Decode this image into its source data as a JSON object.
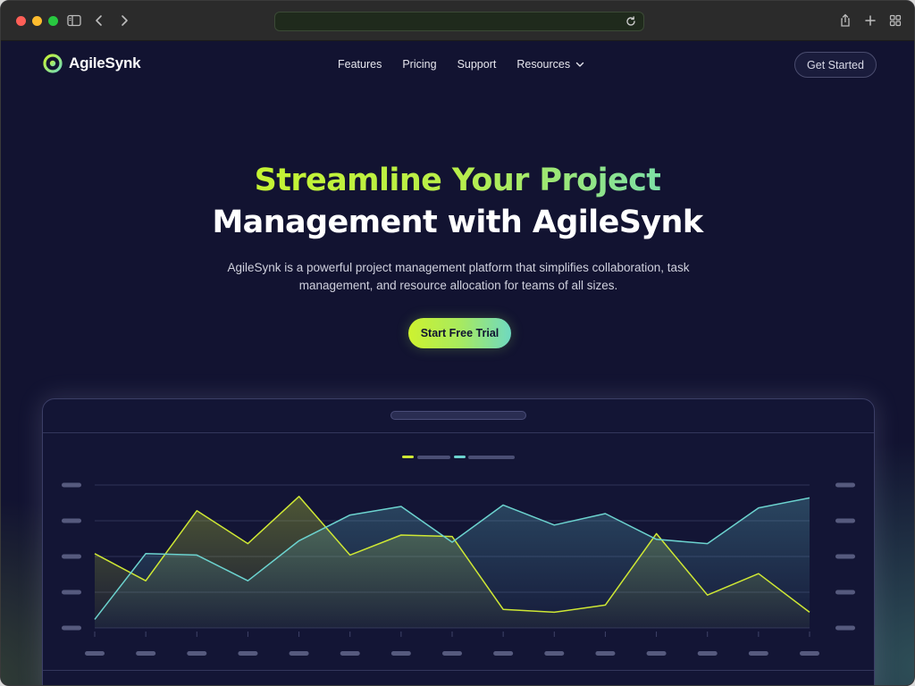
{
  "browser": {
    "window_controls": [
      "close",
      "minimize",
      "zoom"
    ],
    "icons": [
      "sidebar-icon",
      "back-icon",
      "forward-icon",
      "reload-icon",
      "share-icon",
      "new-tab-icon",
      "tab-overview-icon"
    ]
  },
  "brand": {
    "name": "AgileSynk",
    "accent": "#c6f432",
    "accent_teal": "#6fd9c1",
    "background": "#121331"
  },
  "nav": {
    "links": [
      {
        "label": "Features"
      },
      {
        "label": "Pricing"
      },
      {
        "label": "Support"
      },
      {
        "label": "Resources",
        "has_dropdown": true
      }
    ],
    "cta_label": "Get Started"
  },
  "hero": {
    "title_line1": "Streamline Your Project",
    "title_line2": "Management with AgileSynk",
    "subtitle": "AgileSynk is a powerful project management platform that simplifies collaboration, task management, and resource allocation for teams of all sizes.",
    "cta_label": "Start Free Trial"
  },
  "chart_data": {
    "type": "area",
    "title": "",
    "xlabel": "",
    "ylabel": "",
    "x": [
      1,
      2,
      3,
      4,
      5,
      6,
      7,
      8,
      9,
      10,
      11,
      12,
      13,
      14,
      15
    ],
    "ylim": [
      0,
      100
    ],
    "grid": true,
    "legend": "top-center",
    "series": [
      {
        "color": "#cfe834",
        "values": [
          52,
          33,
          82,
          59,
          92,
          51,
          65,
          64,
          13,
          11,
          16,
          66,
          23,
          38,
          11
        ]
      },
      {
        "color": "#6cd3cf",
        "values": [
          6,
          52,
          51,
          33,
          61,
          79,
          85,
          60,
          86,
          72,
          80,
          62,
          59,
          84,
          91
        ]
      }
    ],
    "y_ticks": 5,
    "x_ticks": 15,
    "tick_labels_placeholder": true
  }
}
